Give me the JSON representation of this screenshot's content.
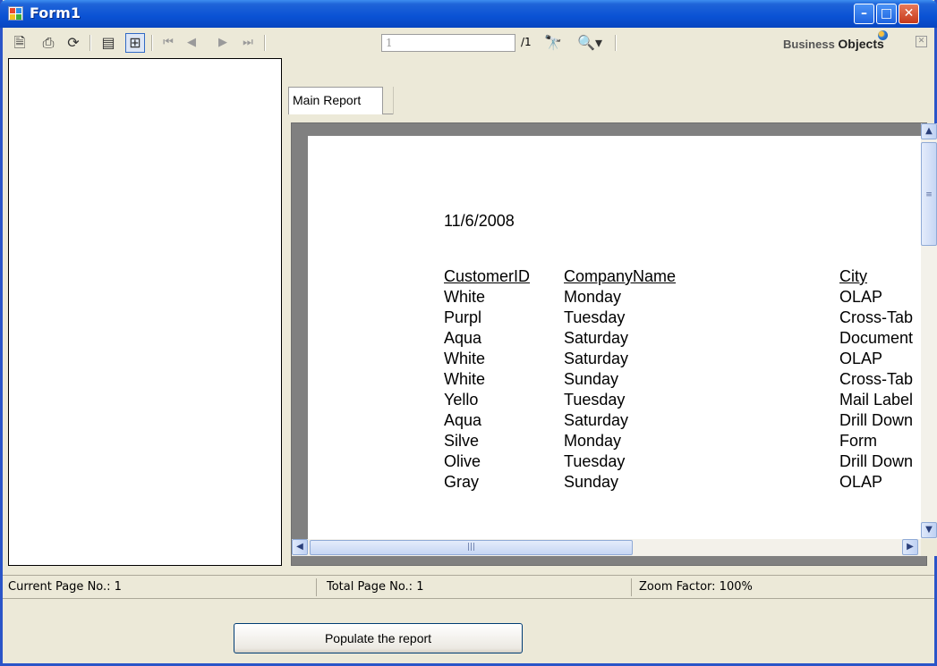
{
  "window": {
    "title": "Form1",
    "controls": {
      "minimize": "–",
      "maximize": "□",
      "close": "✕"
    }
  },
  "toolbar": {
    "current_page_value": "1",
    "page_total": "/1",
    "logo_prefix": "Business ",
    "logo_bold": "Objects",
    "icons": [
      "export-icon",
      "print-icon",
      "refresh-icon",
      "toggle-tree-icon",
      "group-tree-icon",
      "first-page-icon",
      "prev-page-icon",
      "next-page-icon",
      "last-page-icon",
      "find-icon",
      "zoom-icon"
    ]
  },
  "tabs": [
    {
      "label": "Main Report"
    }
  ],
  "report": {
    "date": "11/6/2008",
    "headers": {
      "customer_id": "CustomerID",
      "company_name": "CompanyName",
      "city": "City"
    },
    "rows": [
      {
        "customer_id": "White",
        "company_name": "Monday",
        "city": "OLAP"
      },
      {
        "customer_id": "Purpl",
        "company_name": "Tuesday",
        "city": "Cross-Tab"
      },
      {
        "customer_id": "Aqua",
        "company_name": "Saturday",
        "city": "Document"
      },
      {
        "customer_id": "White",
        "company_name": "Saturday",
        "city": "OLAP"
      },
      {
        "customer_id": "White",
        "company_name": "Sunday",
        "city": "Cross-Tab"
      },
      {
        "customer_id": "Yello",
        "company_name": "Tuesday",
        "city": "Mail Label"
      },
      {
        "customer_id": "Aqua",
        "company_name": "Saturday",
        "city": "Drill Down"
      },
      {
        "customer_id": "Silve",
        "company_name": "Monday",
        "city": "Form"
      },
      {
        "customer_id": "Olive",
        "company_name": "Tuesday",
        "city": "Drill Down"
      },
      {
        "customer_id": "Gray",
        "company_name": "Sunday",
        "city": "OLAP"
      }
    ]
  },
  "status": {
    "current_page": "Current Page No.: 1",
    "total_page": "Total Page No.: 1",
    "zoom": "Zoom Factor: 100%"
  },
  "buttons": {
    "populate": "Populate the report"
  },
  "colors": {
    "titlebar": "#0a52d4",
    "window_bg": "#ece9d8",
    "viewport_bg": "#808080"
  }
}
